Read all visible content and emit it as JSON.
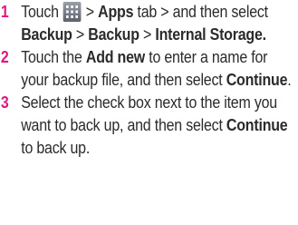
{
  "steps": [
    {
      "number": "1",
      "parts": {
        "a": "Touch ",
        "icon": "apps-grid-icon",
        "b": " > ",
        "c": "Apps",
        "d": " tab > and then select ",
        "e": "Backup",
        "f": " > ",
        "g": "Backup",
        "h": " > ",
        "i": "Internal Storage."
      }
    },
    {
      "number": "2",
      "parts": {
        "a": "Touch the ",
        "b": "Add new",
        "c": " to enter a name for your backup file, and then select ",
        "d": "Continue",
        "e": "."
      }
    },
    {
      "number": "3",
      "parts": {
        "a": "Select the check box next to the item you want to back up, and then select ",
        "b": "Continue",
        "c": " to back up."
      }
    }
  ],
  "colors": {
    "number": "#e1197c",
    "text": "#2b2b2b"
  }
}
